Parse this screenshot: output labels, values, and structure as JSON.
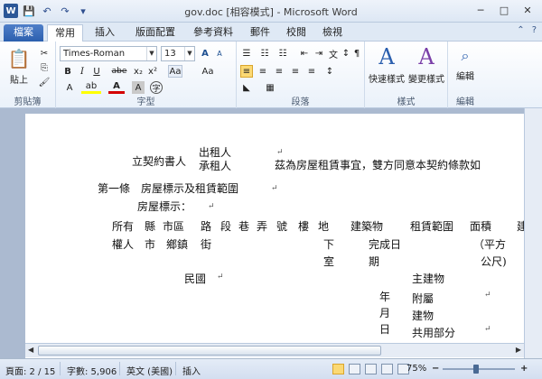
{
  "titlebar": {
    "title": "gov.doc [相容模式] - Microsoft Word",
    "app_icon": "W",
    "qat": {
      "save": "💾",
      "undo": "↶",
      "redo": "↷",
      "more": "▾"
    },
    "controls": {
      "minimize": "─",
      "maximize": "□",
      "close": "✕"
    }
  },
  "ribbon_tabs": {
    "file": "檔案",
    "items": [
      "常用",
      "插入",
      "版面配置",
      "參考資料",
      "郵件",
      "校閱",
      "檢視"
    ],
    "active": "常用",
    "help": "?",
    "collapse": "⌃"
  },
  "clipboard": {
    "label": "剪貼簿",
    "paste": "貼上",
    "cut": "✂",
    "copy": "⎘",
    "format_painter": "🖌"
  },
  "font": {
    "label": "字型",
    "name": "Times-Roman",
    "size": "13",
    "bold": "B",
    "italic": "I",
    "underline": "U",
    "strike": "abe",
    "subscript": "x₂",
    "superscript": "x²",
    "grow": "A",
    "shrink": "A",
    "clear": "Aa",
    "change_case": "Aa",
    "highlight": "ab",
    "font_color": "A",
    "char_shading": "A",
    "enclose": "字"
  },
  "paragraph": {
    "label": "段落",
    "bullets": "☰",
    "numbering": "☷",
    "multilevel": "☷",
    "decrease_indent": "⇤",
    "increase_indent": "⇥",
    "chinese_layout": "文",
    "sort": "↕",
    "show_marks": "¶",
    "align_left": "≡",
    "center": "≡",
    "align_right": "≡",
    "justify": "≡",
    "distributed": "≡",
    "line_spacing": "↕",
    "shading": "◣",
    "borders": "▦"
  },
  "styles": {
    "label": "樣式",
    "quick_styles": "快速樣式",
    "change_styles": "變更樣式"
  },
  "editing": {
    "label": "編輯",
    "name": "編輯"
  },
  "document": {
    "contract_intro": "立契約書人",
    "lessor": "出租人",
    "lessee": "承租人",
    "intro_rest": "茲為房屋租賃事宜，雙方同意本契約條款如",
    "article1": "第一條　房屋標示及租賃範圍",
    "house_label": "房屋標示：",
    "row1": [
      "所有",
      "縣",
      "市區",
      "路",
      "段",
      "巷",
      "弄",
      "號",
      "樓",
      "地",
      "建築物",
      "租賃範圍",
      "面積",
      "建"
    ],
    "row2": [
      "權人",
      "市",
      "鄉鎮",
      "街",
      "下",
      "完成日",
      "（平方"
    ],
    "row3": [
      "室",
      "期",
      "公尺)"
    ],
    "minguo": "民國",
    "main_building": "主建物",
    "ymd": [
      "年",
      "月",
      "日"
    ],
    "attached": "附屬",
    "building": "建物",
    "shared": "共用部分",
    "para_mark": "↵"
  },
  "status": {
    "page": "頁面: 2 / 15",
    "words": "字數: 5,906",
    "language": "英文 (美國)",
    "mode": "插入",
    "zoom": "75%",
    "zoom_level": 0.75,
    "zoom_out": "−",
    "zoom_in": "+"
  },
  "colors": {
    "highlight": "#ffff00",
    "font_color": "#d40000",
    "file_tab": "#2b5fae"
  }
}
